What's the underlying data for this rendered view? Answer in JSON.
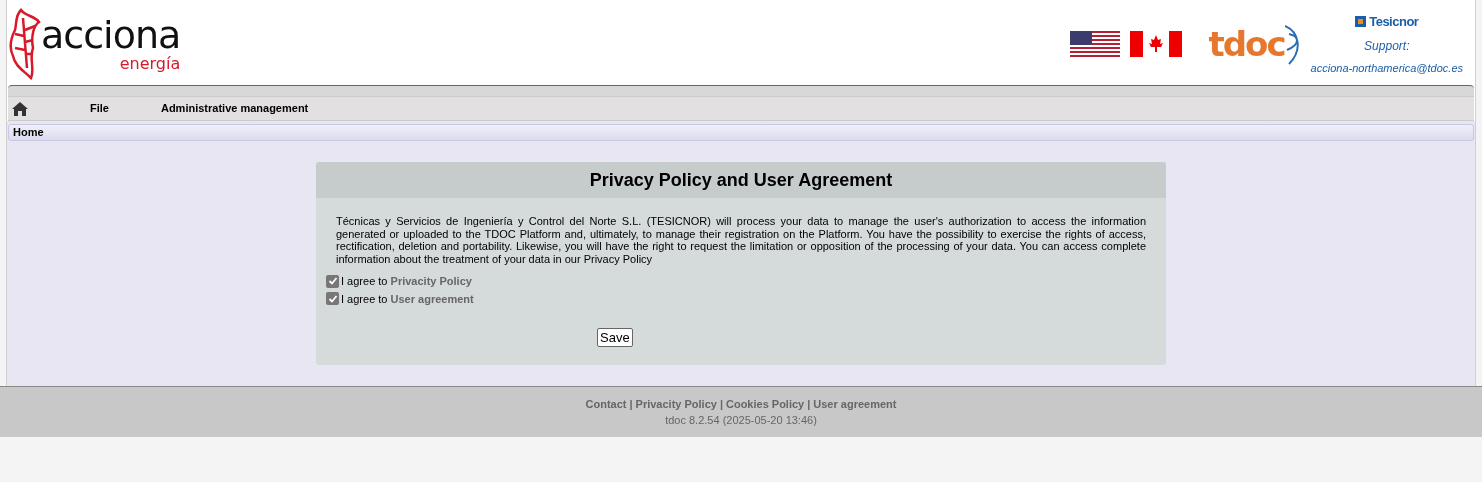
{
  "header": {
    "logo_word": "acciona",
    "logo_sub": "energía",
    "tdoc_logo": "tdoc",
    "vendor_logo": "Tesicnor",
    "support_label": "Support:",
    "support_email": "acciona-northamerica@tdoc.es"
  },
  "menu": [
    {
      "label": "File"
    },
    {
      "label": "Administrative management"
    }
  ],
  "breadcrumb": "Home",
  "dialog": {
    "title": "Privacy Policy and User Agreement",
    "text": "Técnicas y Servicios de Ingeniería y Control del Norte S.L. (TESICNOR) will process your data to manage the user's authorization to access the information generated or uploaded to the TDOC Platform and, ultimately, to manage their registration on the Platform. You have the possibility to exercise the rights of access, rectification, deletion and portability. Likewise, you will have the right to request the limitation or opposition of the processing of your data. You can access complete information about the treatment of your data in our Privacy Policy",
    "agreements": [
      {
        "prefix": "I agree to",
        "link": "Privacity Policy",
        "checked": true
      },
      {
        "prefix": "I agree to",
        "link": "User agreement",
        "checked": true
      }
    ],
    "button": "Save"
  },
  "footer": {
    "links": [
      "Contact",
      "Privacity Policy",
      "Cookies Policy",
      "User agreement"
    ],
    "separator": "|",
    "version": "tdoc 8.2.54 (2025-05-20 13:46)"
  }
}
